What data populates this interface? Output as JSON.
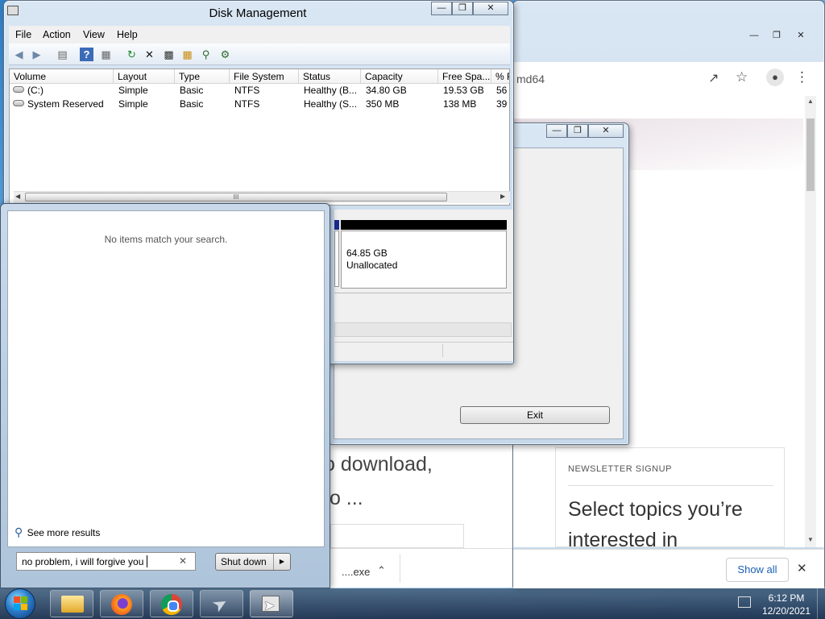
{
  "disk_management": {
    "title": "Disk Management",
    "menu": [
      "File",
      "Action",
      "View",
      "Help"
    ],
    "columns": [
      "Volume",
      "Layout",
      "Type",
      "File System",
      "Status",
      "Capacity",
      "Free Spa...",
      "% F"
    ],
    "rows": [
      {
        "volume": "(C:)",
        "layout": "Simple",
        "type": "Basic",
        "fs": "NTFS",
        "status": "Healthy (B...",
        "capacity": "34.80 GB",
        "free": "19.53 GB",
        "pct": "56"
      },
      {
        "volume": "System Reserved",
        "layout": "Simple",
        "type": "Basic",
        "fs": "NTFS",
        "status": "Healthy (S...",
        "capacity": "350 MB",
        "free": "138 MB",
        "pct": "39"
      }
    ],
    "scroll_grip": "III",
    "unallocated_size": "64.85 GB",
    "unallocated_label": "Unallocated"
  },
  "setup_dialog": {
    "exit_label": "Exit"
  },
  "browser": {
    "address_fragment": "md64",
    "heading_line1": "o download,",
    "heading_line2": "to ...",
    "newsletter_label": "NEWSLETTER SIGNUP",
    "newsletter_text_line1": "Select topics you’re",
    "newsletter_text_line2": "interested in",
    "download_item": "....exe",
    "show_all_label": "Show all"
  },
  "start_menu": {
    "no_results": "No items match your search.",
    "see_more": "See more results",
    "search_value": "no problem, i will forgive you",
    "shutdown_label": "Shut down"
  },
  "taskbar": {
    "time": "6:12 PM",
    "date": "12/20/2021"
  }
}
